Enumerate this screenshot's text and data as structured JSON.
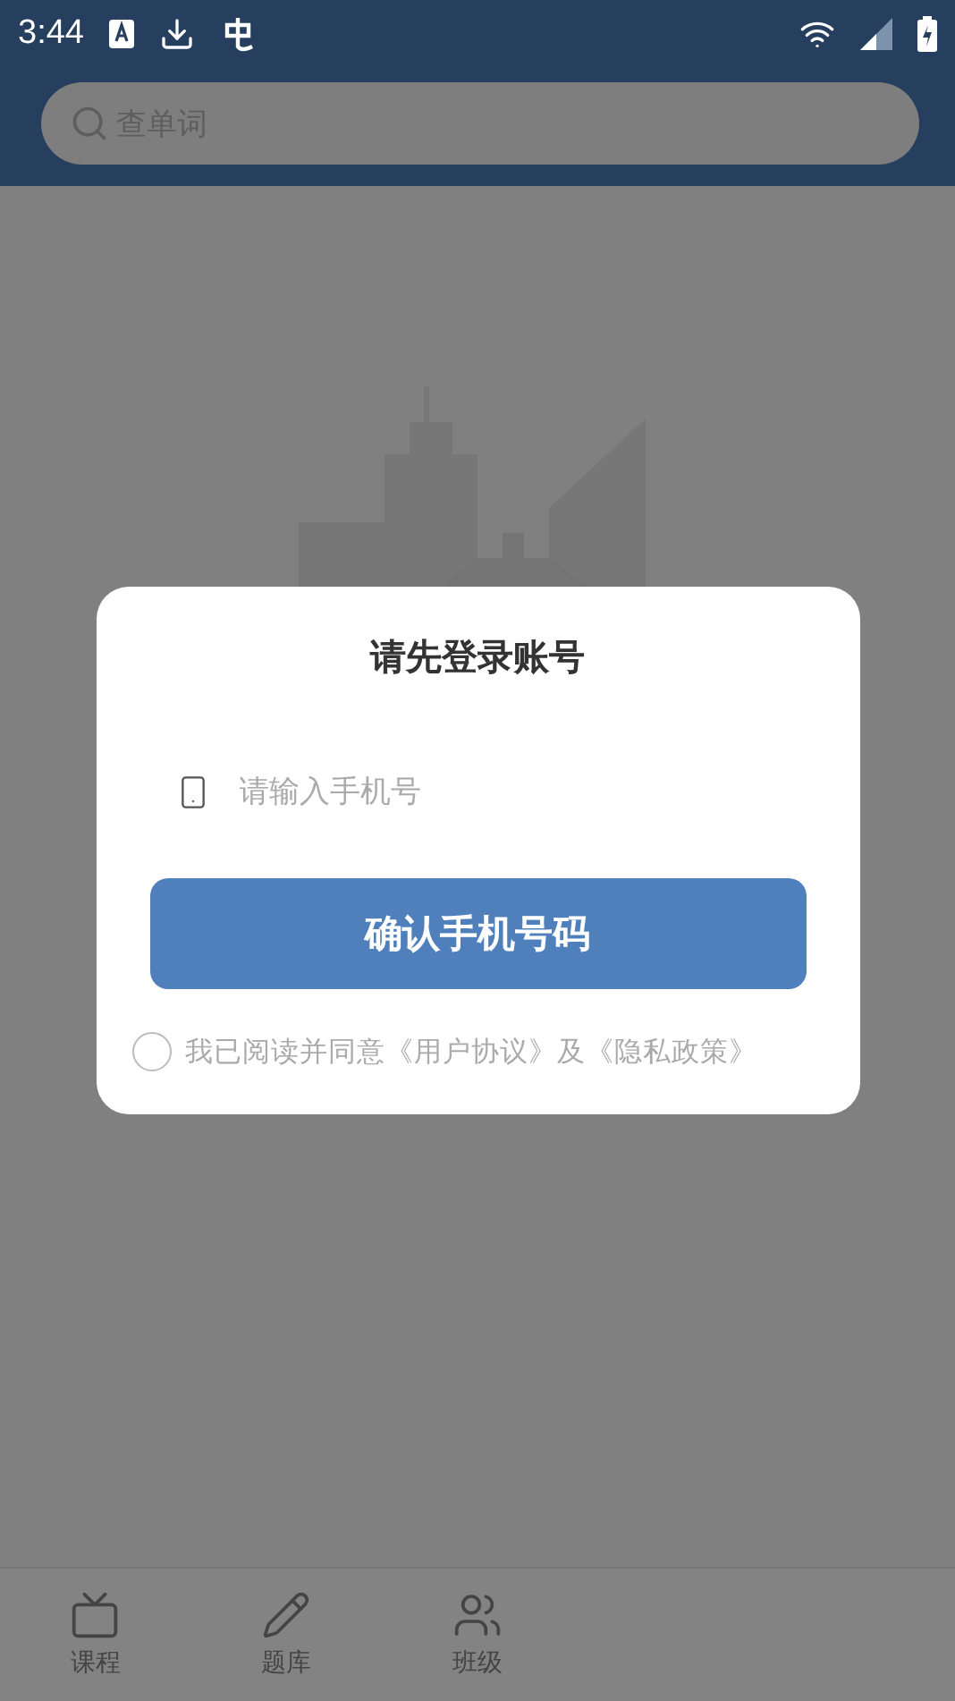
{
  "status_bar": {
    "time": "3:44"
  },
  "search": {
    "placeholder": "查单词"
  },
  "dialog": {
    "title": "请先登录账号",
    "phone_field": {
      "placeholder": "请输入手机号"
    },
    "confirm_button": "确认手机号码",
    "agreement": {
      "checked": false,
      "text": "我已阅读并同意《用户协议》及《隐私政策》"
    }
  },
  "tab_bar": [
    {
      "label": "课程",
      "kind": "tv"
    },
    {
      "label": "题库",
      "kind": "pencil"
    },
    {
      "label": "班级",
      "kind": "users"
    }
  ]
}
